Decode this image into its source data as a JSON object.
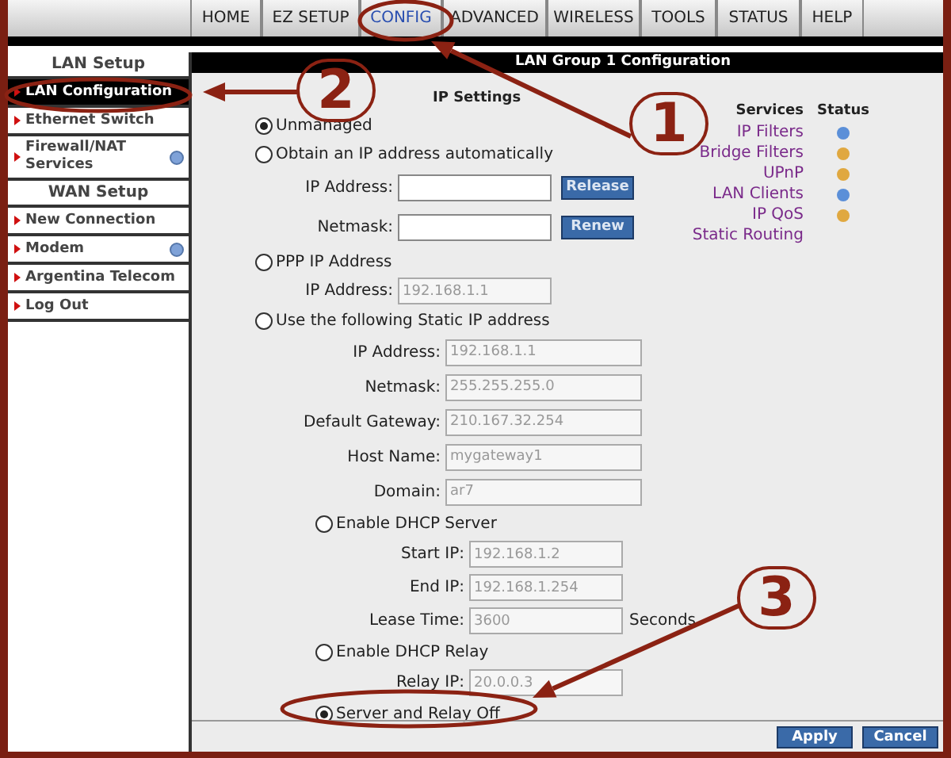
{
  "nav_tabs": [
    {
      "label": "HOME",
      "selected": false
    },
    {
      "label": "EZ SETUP",
      "selected": false
    },
    {
      "label": "CONFIG",
      "selected": true
    },
    {
      "label": "ADVANCED",
      "selected": false
    },
    {
      "label": "WIRELESS",
      "selected": false
    },
    {
      "label": "TOOLS",
      "selected": false
    },
    {
      "label": "STATUS",
      "selected": false
    },
    {
      "label": "HELP",
      "selected": false
    }
  ],
  "sidebar": [
    {
      "kind": "header",
      "label": "LAN Setup"
    },
    {
      "kind": "item",
      "label": "LAN Configuration",
      "selected": true,
      "status_icon": false
    },
    {
      "kind": "item",
      "label": "Ethernet Switch",
      "selected": false,
      "status_icon": false
    },
    {
      "kind": "item",
      "label": "Firewall/NAT Services",
      "selected": false,
      "status_icon": true
    },
    {
      "kind": "header",
      "label": "WAN Setup"
    },
    {
      "kind": "item",
      "label": "New Connection",
      "selected": false,
      "status_icon": false
    },
    {
      "kind": "item",
      "label": "Modem",
      "selected": false,
      "status_icon": true
    },
    {
      "kind": "item",
      "label": "Argentina Telecom",
      "selected": false,
      "status_icon": false
    },
    {
      "kind": "item",
      "label": "Log Out",
      "selected": false,
      "status_icon": false
    }
  ],
  "page_title": "LAN Group 1 Configuration",
  "ip_settings": {
    "title": "IP Settings",
    "options": [
      {
        "label": "Unmanaged",
        "selected": true
      },
      {
        "label": "Obtain an IP address automatically",
        "selected": false,
        "fields": [
          {
            "label": "IP Address:",
            "disabled": false,
            "button": "Release"
          },
          {
            "label": "Netmask:",
            "disabled": false,
            "button": "Renew"
          }
        ]
      },
      {
        "label": "PPP IP Address",
        "selected": false,
        "fields": [
          {
            "label": "IP Address:",
            "value": "192.168.1.1",
            "disabled": true
          }
        ]
      },
      {
        "label": "Use the following Static IP address",
        "selected": false,
        "fields": [
          {
            "label": "IP Address:",
            "value": "192.168.1.1",
            "disabled": true
          },
          {
            "label": "Netmask:",
            "value": "255.255.255.0",
            "disabled": true
          },
          {
            "label": "Default Gateway:",
            "value": "210.167.32.254",
            "disabled": true
          },
          {
            "label": "Host Name:",
            "value": "mygateway1",
            "disabled": true
          },
          {
            "label": "Domain:",
            "value": "ar7",
            "disabled": true
          }
        ],
        "children": [
          {
            "label": "Enable DHCP Server",
            "selected": false,
            "fields": [
              {
                "label": "Start IP:",
                "value": "192.168.1.2",
                "disabled": true
              },
              {
                "label": "End IP:",
                "value": "192.168.1.254",
                "disabled": true
              },
              {
                "label": "Lease Time:",
                "value": "3600",
                "disabled": true,
                "unit": "Seconds"
              }
            ]
          },
          {
            "label": "Enable DHCP Relay",
            "selected": false,
            "fields": [
              {
                "label": "Relay IP:",
                "value": "20.0.0.3",
                "disabled": true
              }
            ]
          },
          {
            "label": "Server and Relay Off",
            "selected": true
          }
        ]
      }
    ]
  },
  "services": {
    "header": "Services",
    "status_header": "Status",
    "items": [
      {
        "label": "IP Filters",
        "color": "#5b8fd8"
      },
      {
        "label": "Bridge Filters",
        "color": "#e0a840"
      },
      {
        "label": "UPnP",
        "color": "#e0a840"
      },
      {
        "label": "LAN Clients",
        "color": "#5b8fd8"
      },
      {
        "label": "IP QoS",
        "color": "#e0a840"
      },
      {
        "label": "Static Routing"
      }
    ]
  },
  "buttons": [
    "Apply",
    "Cancel"
  ],
  "annotations": [
    {
      "label": "1"
    },
    {
      "label": "2"
    },
    {
      "label": "3"
    }
  ]
}
